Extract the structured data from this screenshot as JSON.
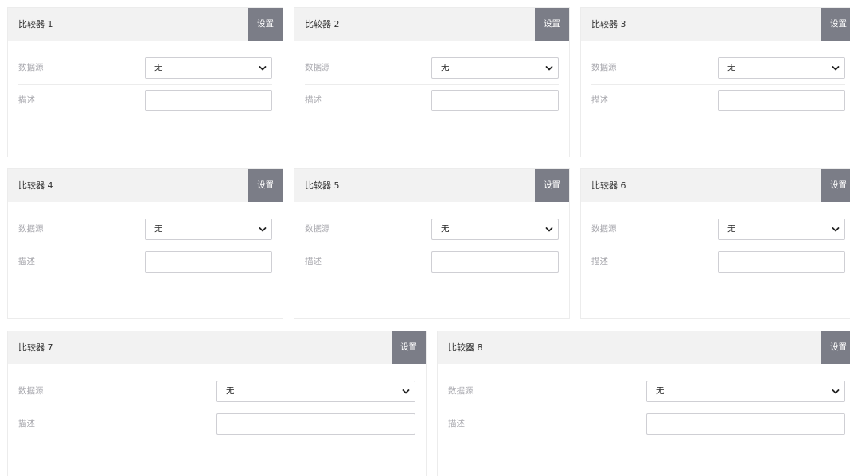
{
  "settings_label": "设置",
  "data_source_label": "数据源",
  "description_label": "描述",
  "comparators": [
    {
      "title": "比较器 1",
      "data_source": "无",
      "description": ""
    },
    {
      "title": "比较器 2",
      "data_source": "无",
      "description": ""
    },
    {
      "title": "比较器 3",
      "data_source": "无",
      "description": ""
    },
    {
      "title": "比较器 4",
      "data_source": "无",
      "description": ""
    },
    {
      "title": "比较器 5",
      "data_source": "无",
      "description": ""
    },
    {
      "title": "比较器 6",
      "data_source": "无",
      "description": ""
    },
    {
      "title": "比较器 7",
      "data_source": "无",
      "description": ""
    },
    {
      "title": "比较器 8",
      "data_source": "无",
      "description": ""
    }
  ],
  "colors": {
    "header_bg": "#f2f2f2",
    "settings_button_bg": "#7b7d87",
    "settings_button_text": "#ffffff",
    "field_label": "#a7a7ad",
    "border": "#ececec"
  }
}
